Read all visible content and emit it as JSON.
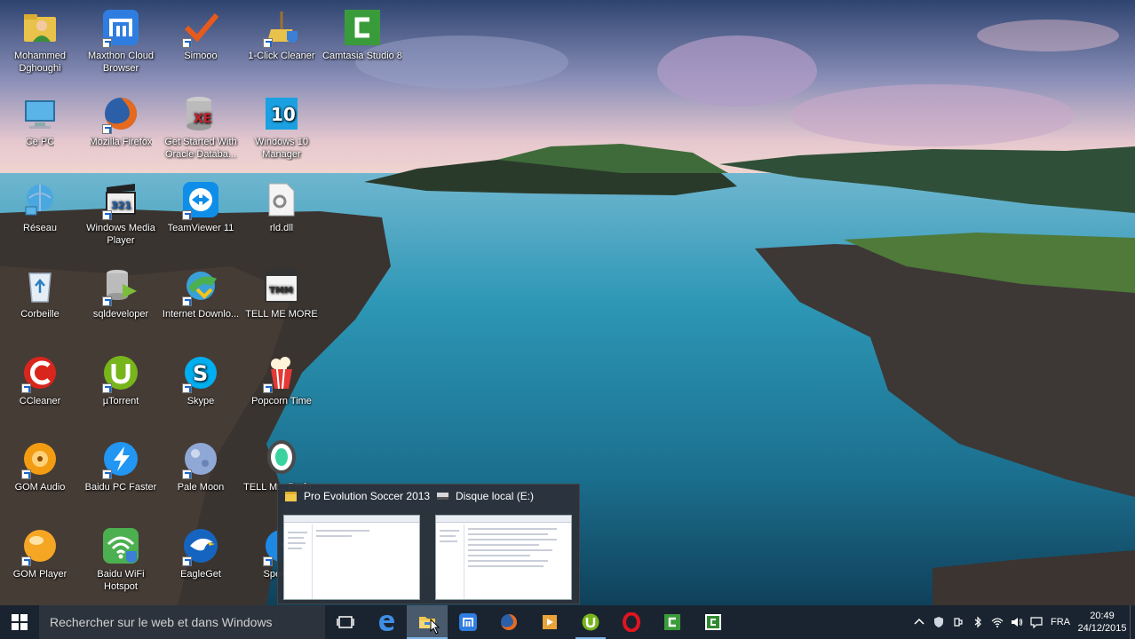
{
  "desktop": {
    "icons": [
      {
        "label": "Mohammed Dghoughi",
        "icon": "user-folder-icon",
        "color": "#e8c24a"
      },
      {
        "label": "Maxthon Cloud Browser",
        "icon": "maxthon-icon",
        "color": "#2f7de1"
      },
      {
        "label": "Simooo",
        "icon": "checkmark-icon",
        "color": "#e85a1b"
      },
      {
        "label": "1-Click Cleaner",
        "icon": "broom-shield-icon",
        "color": "#3b7fd6"
      },
      {
        "label": "Camtasia Studio 8",
        "icon": "camtasia-icon",
        "color": "#3a9b3a"
      },
      {
        "label": "Ce PC",
        "icon": "computer-icon",
        "color": "#5ab4e8"
      },
      {
        "label": "Mozilla Firefox",
        "icon": "firefox-icon",
        "color": "#e66a1e"
      },
      {
        "label": "Get Started With Oracle Databa...",
        "icon": "oracle-db-icon",
        "color": "#c6202b"
      },
      {
        "label": "Windows 10 Manager",
        "icon": "windows10-icon",
        "color": "#1ba1e2"
      },
      {
        "label": "Réseau",
        "icon": "network-globe-icon",
        "color": "#4aa8e0"
      },
      {
        "label": "Windows Media Player",
        "icon": "clapperboard-icon",
        "color": "#222222"
      },
      {
        "label": "TeamViewer 11",
        "icon": "teamviewer-icon",
        "color": "#0e8ee9"
      },
      {
        "label": "rld.dll",
        "icon": "dll-file-icon",
        "color": "#dddddd"
      },
      {
        "label": "Corbeille",
        "icon": "recycle-bin-icon",
        "color": "#bcd"
      },
      {
        "label": "sqldeveloper",
        "icon": "database-icon",
        "color": "#7cbd3b"
      },
      {
        "label": "Internet Downlo...",
        "icon": "idm-icon",
        "color": "#4caf50"
      },
      {
        "label": "TELL ME MORE",
        "icon": "tellmemore-icon",
        "color": "#333333"
      },
      {
        "label": "CCleaner",
        "icon": "ccleaner-icon",
        "color": "#d9261c"
      },
      {
        "label": "µTorrent",
        "icon": "utorrent-icon",
        "color": "#77b51b"
      },
      {
        "label": "Skype",
        "icon": "skype-icon",
        "color": "#00aff0"
      },
      {
        "label": "Popcorn Time",
        "icon": "popcorn-icon",
        "color": "#e53935"
      },
      {
        "label": "GOM Audio",
        "icon": "gom-audio-icon",
        "color": "#f39c12"
      },
      {
        "label": "Baidu PC Faster",
        "icon": "baidu-faster-icon",
        "color": "#2196f3"
      },
      {
        "label": "Pale Moon",
        "icon": "palemoon-icon",
        "color": "#5b7fb5"
      },
      {
        "label": "TELL M... Perfo...",
        "icon": "tellme-perf-icon",
        "color": "#4a4a4a"
      },
      {
        "label": "GOM Player",
        "icon": "gom-player-icon",
        "color": "#f5a623"
      },
      {
        "label": "Baidu WiFi Hotspot",
        "icon": "wifi-hotspot-icon",
        "color": "#4caf50"
      },
      {
        "label": "EagleGet",
        "icon": "eagle-icon",
        "color": "#1565c0"
      },
      {
        "label": "Speed...",
        "icon": "speed-icon",
        "color": "#1e88e5"
      }
    ]
  },
  "preview": {
    "windows": [
      {
        "title": "Pro Evolution Soccer 2013",
        "icon": "folder-icon"
      },
      {
        "title": "Disque local (E:)",
        "icon": "drive-icon"
      }
    ]
  },
  "taskbar": {
    "search_placeholder": "Rechercher sur le web et dans Windows",
    "apps": [
      {
        "name": "task-view",
        "icon": "task-view-icon"
      },
      {
        "name": "edge",
        "icon": "edge-icon"
      },
      {
        "name": "file-explorer",
        "icon": "folder-icon"
      },
      {
        "name": "maxthon",
        "icon": "maxthon-icon"
      },
      {
        "name": "firefox",
        "icon": "firefox-icon"
      },
      {
        "name": "media-player",
        "icon": "media-player-icon"
      },
      {
        "name": "utorrent",
        "icon": "utorrent-icon"
      },
      {
        "name": "opera",
        "icon": "opera-icon"
      },
      {
        "name": "camtasia-recorder",
        "icon": "camtasia-icon"
      },
      {
        "name": "camtasia-studio",
        "icon": "camtasia-icon"
      }
    ],
    "tray": {
      "language": "FRA",
      "time": "20:49",
      "date": "24/12/2015"
    }
  }
}
